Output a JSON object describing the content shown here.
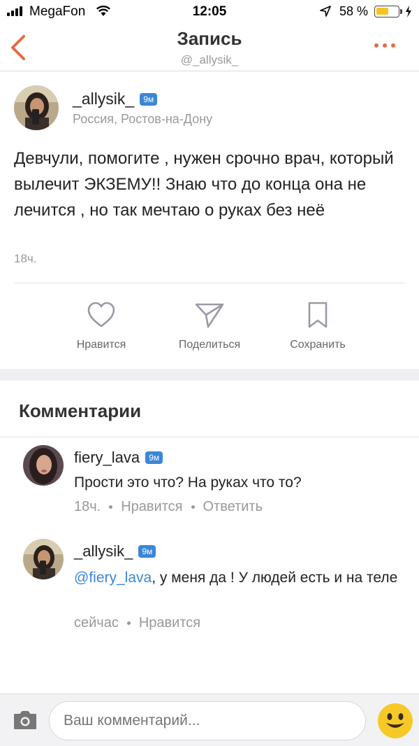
{
  "status_bar": {
    "carrier": "MegaFon",
    "time": "12:05",
    "battery_percent_text": "58 %",
    "battery_level": 0.58
  },
  "nav": {
    "title": "Запись",
    "subtitle": "@_allysik_"
  },
  "post": {
    "author": "_allysik_",
    "badge": "9м",
    "location": "Россия, Ростов-на-Дону",
    "text": "Девчули, помогите , нужен срочно врач, который вылечит ЭКЗЕМУ!!  Знаю что до конца она не лечится , но так мечтаю о руках без неё",
    "time": "18ч."
  },
  "actions": {
    "like": "Нравится",
    "share": "Поделиться",
    "save": "Сохранить"
  },
  "comments_title": "Комментарии",
  "comments": [
    {
      "author": "fiery_lava",
      "badge": "9м",
      "text": "Прости это что? На руках что то?",
      "time": "18ч.",
      "like": "Нравится",
      "reply": "Ответить"
    },
    {
      "author": "_allysik_",
      "badge": "9м",
      "mention": "@fiery_lava",
      "text": ", у меня да ! У людей есть и на теле",
      "time": "сейчас",
      "like": "Нравится"
    }
  ],
  "composer": {
    "placeholder": "Ваш комментарий..."
  },
  "colors": {
    "accent": "#e46a4a",
    "badge": "#3c86d8",
    "link": "#3c86d8",
    "battery": "#f6c522"
  },
  "icons": [
    "back-chevron-icon",
    "more-dots-icon",
    "heart-icon",
    "paper-plane-icon",
    "bookmark-icon",
    "camera-icon",
    "smiley-emoji-icon"
  ]
}
